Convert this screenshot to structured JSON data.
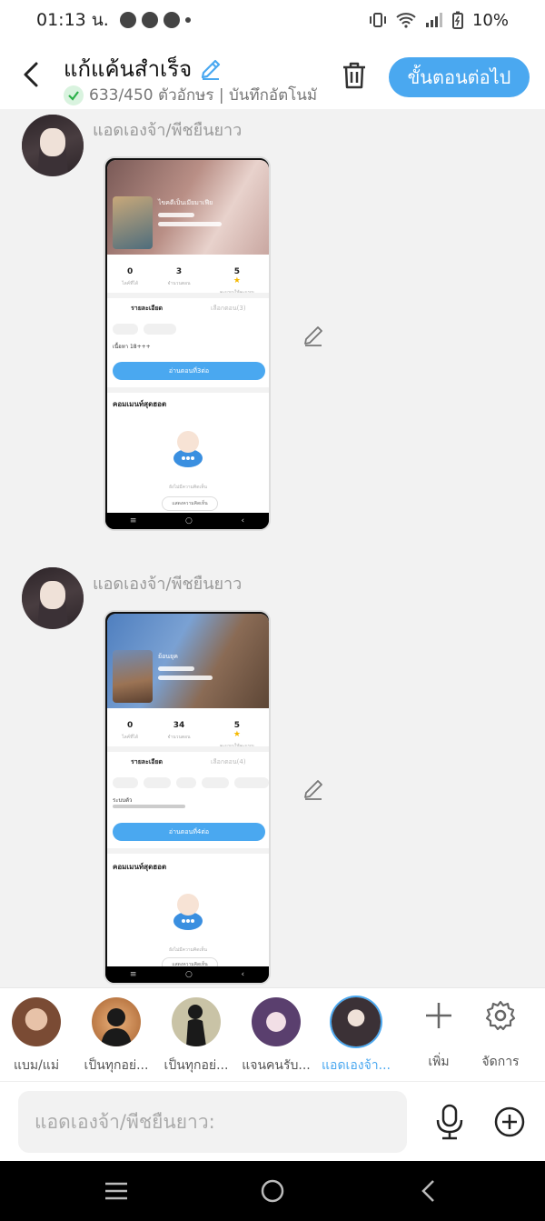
{
  "status_bar": {
    "time": "01:13 น.",
    "battery": "10%"
  },
  "header": {
    "title": "แก้แค้นสำเร็จ",
    "subtitle": "633/450 ตัวอักษร | บันทึกอัตโนมัติ",
    "next_label": "ขั้นตอนต่อไป",
    "accent_color": "#4aa8f0"
  },
  "messages": [
    {
      "sender": "แอดเองจ้า/พีชยืนยาว",
      "screenshot": {
        "title": "ไขคดีเป็นเมียมาเฟีย",
        "stats": [
          {
            "value": "0",
            "label": "ไลค์ที่ได้"
          },
          {
            "value": "3",
            "label": "จำนวนตอน"
          },
          {
            "value": "5",
            "label": "คะแนนให้คะแนน"
          }
        ],
        "tab_detail": "รายละเอียด",
        "tab_episodes": "เลือกตอน(3)",
        "description": "เนื้อหา 18+++",
        "cta": "อ่านตอนที่3ต่อ",
        "comments_title": "คอมเมนท์สุดฮอต",
        "empty_comment": "ยังไม่มีความคิดเห็น",
        "comment_button": "แสดงความคิดเห็น"
      }
    },
    {
      "sender": "แอดเองจ้า/พีชยืนยาว",
      "screenshot": {
        "title": "ย้อนยุค",
        "stats": [
          {
            "value": "0",
            "label": "ไลค์ที่ได้"
          },
          {
            "value": "34",
            "label": "จำนวนตอน"
          },
          {
            "value": "5",
            "label": "คะแนนให้คะแนน"
          }
        ],
        "tab_detail": "รายละเอียด",
        "tab_episodes": "เลือกตอน(4)",
        "description": "ระบบตัว",
        "cta": "อ่านตอนที่4ต่อ",
        "comments_title": "คอมเมนท์สุดฮอต",
        "empty_comment": "ยังไม่มีความคิดเห็น",
        "comment_button": "แสดงความคิดเห็น"
      }
    }
  ],
  "personas": [
    {
      "label": "แบม/แม่",
      "active": false
    },
    {
      "label": "เป็นทุกอย่...",
      "active": false
    },
    {
      "label": "เป็นทุกอย่...",
      "active": false
    },
    {
      "label": "แจนคนรับ...",
      "active": false
    },
    {
      "label": "แอดเองจ้า...",
      "active": true
    }
  ],
  "tools": {
    "add_label": "เพิ่ม",
    "manage_label": "จัดการ"
  },
  "composer": {
    "placeholder": "แอดเองจ้า/พีชยืนยาว:"
  }
}
